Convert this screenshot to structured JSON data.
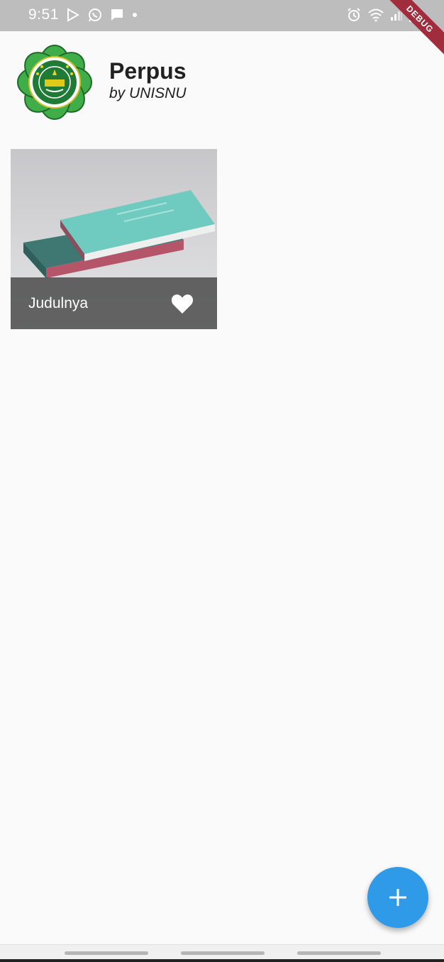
{
  "status_bar": {
    "time": "9:51",
    "left_icons": [
      "play-store-icon",
      "whatsapp-icon",
      "message-icon",
      "dot-icon"
    ],
    "right_icons": [
      "alarm-icon",
      "wifi-icon",
      "signal-icon",
      "battery-icon"
    ],
    "background": "#bdbdbd"
  },
  "debug_banner": "DEBUG",
  "header": {
    "logo_icon": "unisnu-logo",
    "title": "Perpus",
    "subtitle": "by UNISNU"
  },
  "books": [
    {
      "title": "Judulnya",
      "cover_icon": "book-cover-image",
      "favorite": true
    }
  ],
  "fab": {
    "icon": "add-icon",
    "color": "#2f9be8"
  },
  "colors": {
    "background": "#fafafa",
    "accent": "#2f9be8",
    "logo_green": "#3fae49"
  }
}
